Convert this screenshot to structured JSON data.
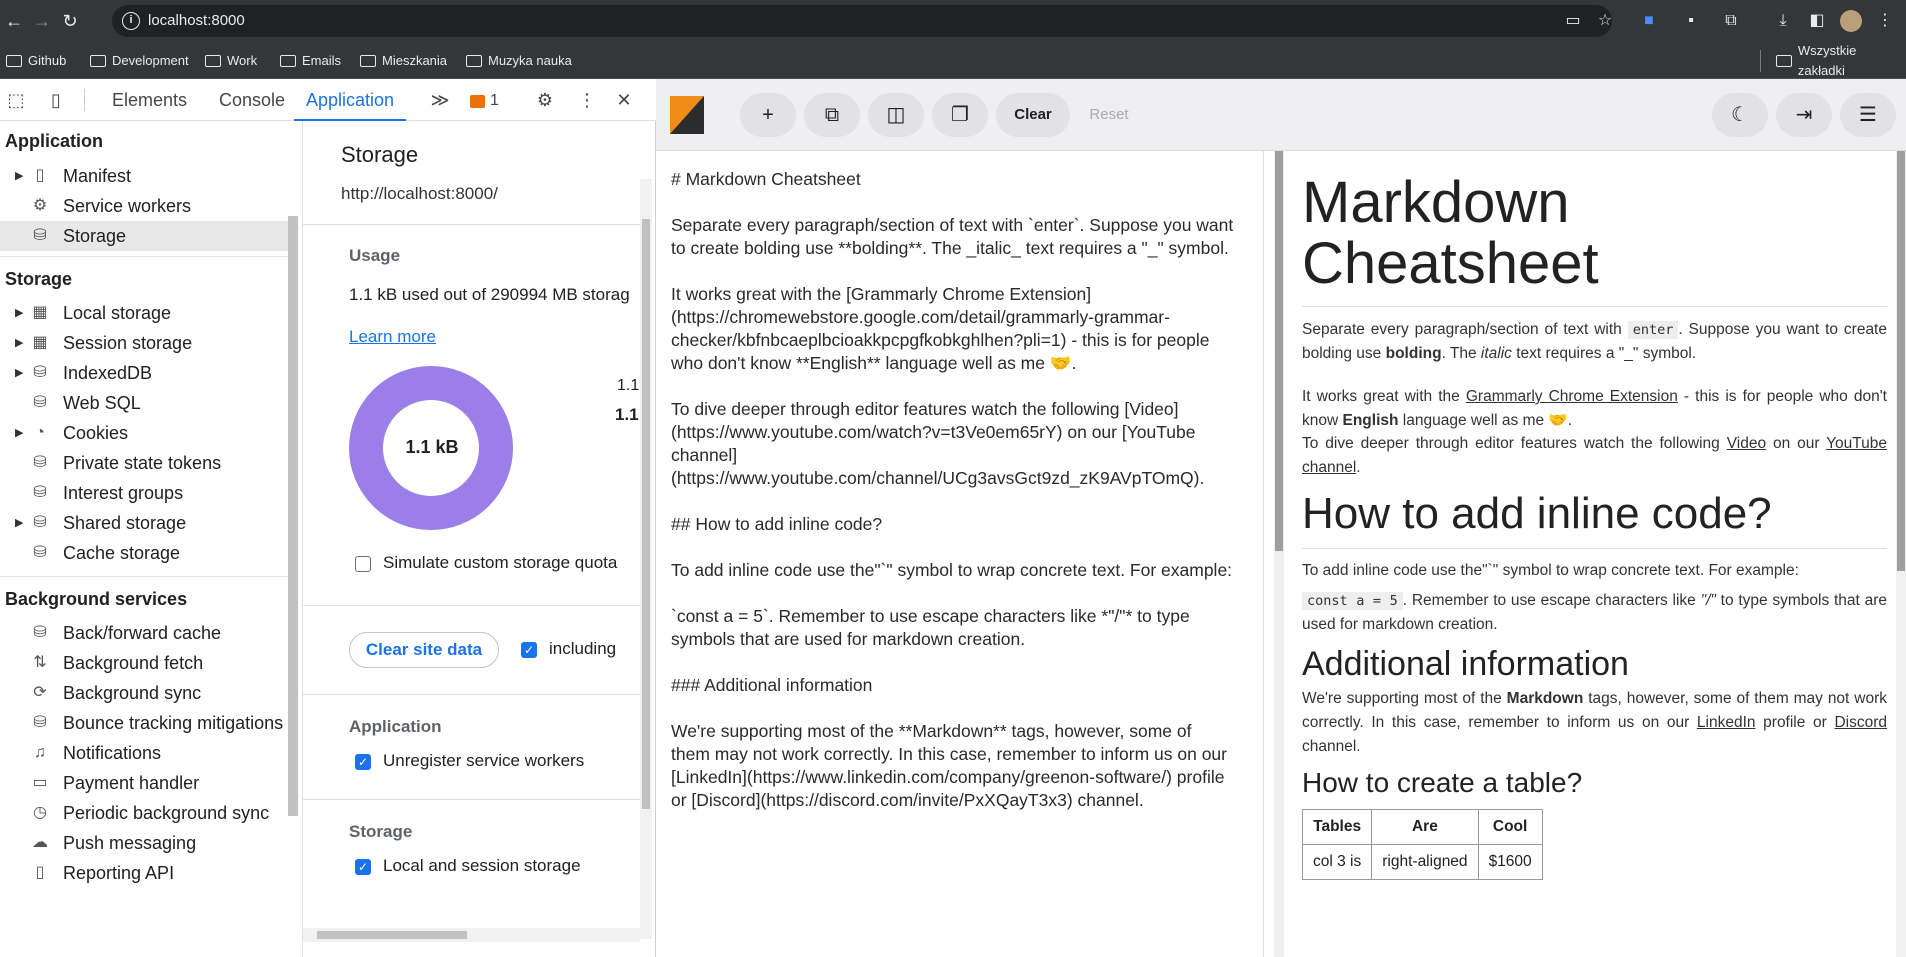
{
  "browser": {
    "url": "localhost:8000",
    "bookmarks": [
      "Github",
      "Development",
      "Work",
      "Emails",
      "Mieszkania",
      "Muzyka nauka"
    ],
    "all_bookmarks": "Wszystkie zakładki"
  },
  "devtools": {
    "tabs": [
      "Elements",
      "Console",
      "Application"
    ],
    "active_tab": "Application",
    "issues_count": "1",
    "sidebar": {
      "application_title": "Application",
      "application_items": [
        "Manifest",
        "Service workers",
        "Storage"
      ],
      "storage_title": "Storage",
      "storage_items": [
        "Local storage",
        "Session storage",
        "IndexedDB",
        "Web SQL",
        "Cookies",
        "Private state tokens",
        "Interest groups",
        "Shared storage",
        "Cache storage"
      ],
      "background_title": "Background services",
      "background_items": [
        "Back/forward cache",
        "Background fetch",
        "Background sync",
        "Bounce tracking mitigations",
        "Notifications",
        "Payment handler",
        "Periodic background sync",
        "Push messaging",
        "Reporting API"
      ]
    },
    "main": {
      "title": "Storage",
      "origin": "http://localhost:8000/",
      "usage_title": "Usage",
      "usage_text": "1.1 kB used out of 290994 MB storag",
      "learn_more": "Learn more",
      "donut_label": "1.1 kB",
      "legend_a": "1.1",
      "legend_b": "1.1",
      "simulate_label": "Simulate custom storage quota",
      "clear_button": "Clear site data",
      "including_label": "including",
      "app_section": "Application",
      "unregister_label": "Unregister service workers",
      "storage_section": "Storage",
      "local_session_label": "Local and session storage"
    }
  },
  "app": {
    "toolbar": {
      "clear": "Clear",
      "reset": "Reset"
    },
    "editor_lines": [
      "# Markdown Cheatsheet",
      "",
      "Separate every paragraph/section of text with `enter`. Suppose you want",
      "to create bolding use **bolding**. The _italic_ text requires a \"_\" symbol.",
      "",
      "It works great with the [Grammarly Chrome Extension]",
      "(https://chromewebstore.google.com/detail/grammarly-grammar-",
      "checker/kbfnbcaeplbcioakkpcpgfkobkghlhen?pli=1) - this is for people",
      "who don't know **English** language well as me 🤝.",
      "",
      "To dive deeper through editor features watch the following [Video]",
      "(https://www.youtube.com/watch?v=t3Ve0em65rY) on our [YouTube",
      "channel]",
      "(https://www.youtube.com/channel/UCg3avsGct9zd_zK9AVpTOmQ).",
      "",
      "## How to add inline code?",
      "",
      "To add inline code use the\"`\" symbol to wrap concrete text. For example:",
      "",
      "`const a = 5`. Remember to use escape characters like *\"/\"* to type",
      "symbols that are used for markdown creation.",
      "",
      "### Additional information",
      "",
      "We're supporting most of the **Markdown** tags, however, some of",
      "them may not work correctly. In this case, remember to inform us on our",
      "[LinkedIn](https://www.linkedin.com/company/greenon-software/) profile",
      "or [Discord](https://discord.com/invite/PxXQayT3x3) channel."
    ],
    "preview": {
      "h1_line1": "Markdown",
      "h1_line2": "Cheatsheet",
      "p1_a": "Separate every paragraph/section of text with",
      "p1_code": "enter",
      "p1_b": ". Suppose you want to create bolding use",
      "p1_bold": "bolding",
      "p1_c": ". The",
      "p1_italic": "italic",
      "p1_d": "text requires a \"_\" symbol.",
      "p2_a": "It works great with the",
      "p2_link": "Grammarly Chrome Extension",
      "p2_b": "- this is for people who don't know",
      "p2_bold": "English",
      "p2_c": "language well as me 🤝.",
      "p3_a": "To dive deeper through editor features watch the following",
      "p3_link1": "Video",
      "p3_b": "on our",
      "p3_link2": "YouTube channel",
      "p3_c": ".",
      "h2": "How to add inline code?",
      "p4": "To add inline code use the\"`\" symbol to wrap concrete text. For example:",
      "p5_code": "const a = 5",
      "p5_a": ". Remember to use escape characters like",
      "p5_italic": "\"/\"",
      "p5_b": "to type symbols that are used for markdown creation.",
      "h3": "Additional information",
      "p6_a": "We're supporting most of the",
      "p6_bold": "Markdown",
      "p6_b": "tags, however, some of them may not work correctly. In this case, remember to inform us on our",
      "p6_link1": "LinkedIn",
      "p6_c": "profile or",
      "p6_link2": "Discord",
      "p6_d": "channel.",
      "h4": "How to create a table?",
      "table_headers": [
        "Tables",
        "Are",
        "Cool"
      ],
      "table_row": [
        "col 3 is",
        "right-aligned",
        "$1600"
      ]
    }
  },
  "colors": {
    "accent": "#1a73e8",
    "donut": "#9b7ee8",
    "chrome_bg": "#35363a"
  }
}
